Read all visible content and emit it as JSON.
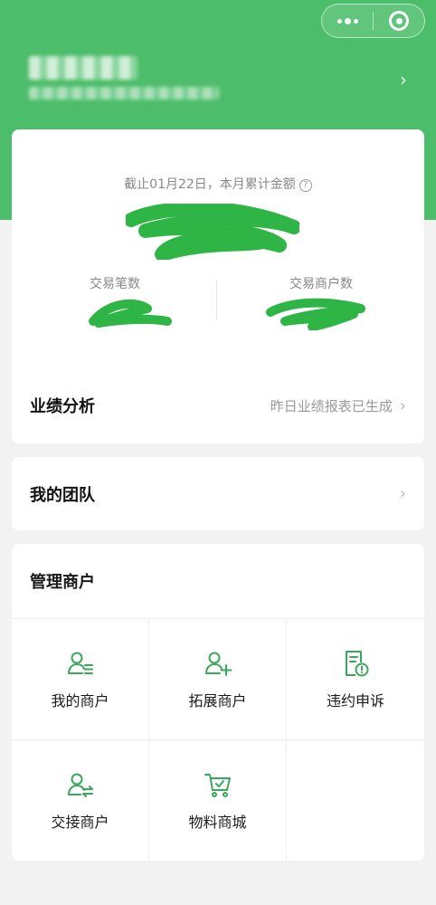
{
  "summary": {
    "as_of": "截止01月22日，本月累计金额",
    "help_icon": "?",
    "trade_count_label": "交易笔数",
    "trade_merchant_count_label": "交易商户数"
  },
  "performance": {
    "title": "业绩分析",
    "status": "昨日业绩报表已生成"
  },
  "team": {
    "title": "我的团队"
  },
  "merchant": {
    "title": "管理商户",
    "items": [
      {
        "label": "我的商户",
        "icon": "user-list-icon"
      },
      {
        "label": "拓展商户",
        "icon": "user-add-icon"
      },
      {
        "label": "违约申诉",
        "icon": "document-alert-icon"
      },
      {
        "label": "交接商户",
        "icon": "user-transfer-icon"
      },
      {
        "label": "物料商城",
        "icon": "shopping-cart-icon"
      }
    ]
  },
  "colors": {
    "brand": "#4cbd6a",
    "icon_green": "#3aa85a",
    "redaction": "#2fb545"
  }
}
